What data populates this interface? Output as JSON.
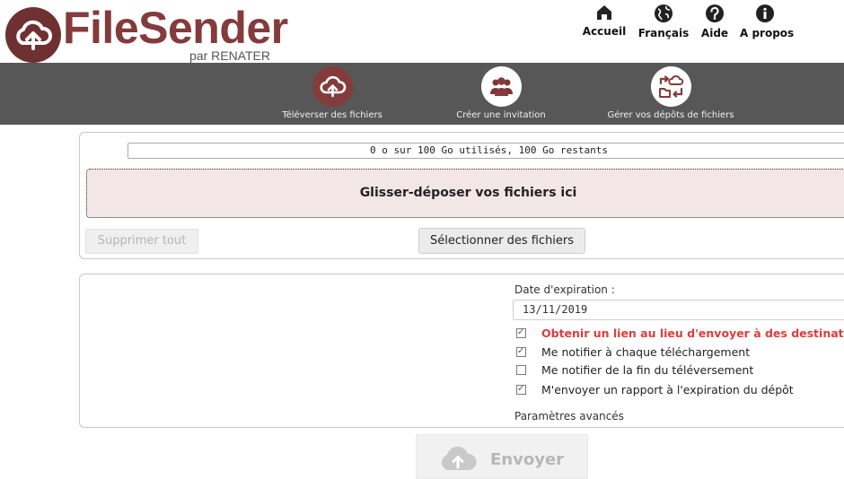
{
  "logo": {
    "name": "FileSender",
    "subtitle": "par RENATER"
  },
  "topnav": [
    {
      "label": "Accueil",
      "icon": "home-icon"
    },
    {
      "label": "Français",
      "icon": "globe-icon"
    },
    {
      "label": "Aide",
      "icon": "help-icon"
    },
    {
      "label": "A propos",
      "icon": "info-icon"
    }
  ],
  "toolbar": [
    {
      "label": "Téléverser des fichiers",
      "icon": "upload-cloud-icon",
      "active": true
    },
    {
      "label": "Créer une invitation",
      "icon": "users-icon"
    },
    {
      "label": "Gérer vos dépôts de fichiers",
      "icon": "transfers-icon"
    }
  ],
  "upload": {
    "quota": "0 o sur 100 Go utilisés, 100 Go restants",
    "dropzone": "Glisser-déposer vos fichiers ici",
    "clear_all": "Supprimer tout",
    "select_files": "Sélectionner des fichiers"
  },
  "options": {
    "expiration_label": "Date d'expiration :",
    "expiration_value": "13/11/2019",
    "checkboxes": [
      {
        "label": "Obtenir un lien au lieu d'envoyer à des destinataires",
        "checked": true,
        "highlight": true
      },
      {
        "label": "Me notifier à chaque téléchargement",
        "checked": true
      },
      {
        "label": "Me notifier de la fin du téléversement",
        "checked": false
      },
      {
        "label": "M'envoyer un rapport à l'expiration du dépôt",
        "checked": true
      }
    ],
    "advanced": "Paramètres avancés"
  },
  "send": {
    "label": "Envoyer"
  },
  "colors": {
    "brand": "#843b3b",
    "toolbar_bg": "#575757",
    "dropzone_bg": "#f3e6e6",
    "highlight_text": "#e23b3b"
  }
}
